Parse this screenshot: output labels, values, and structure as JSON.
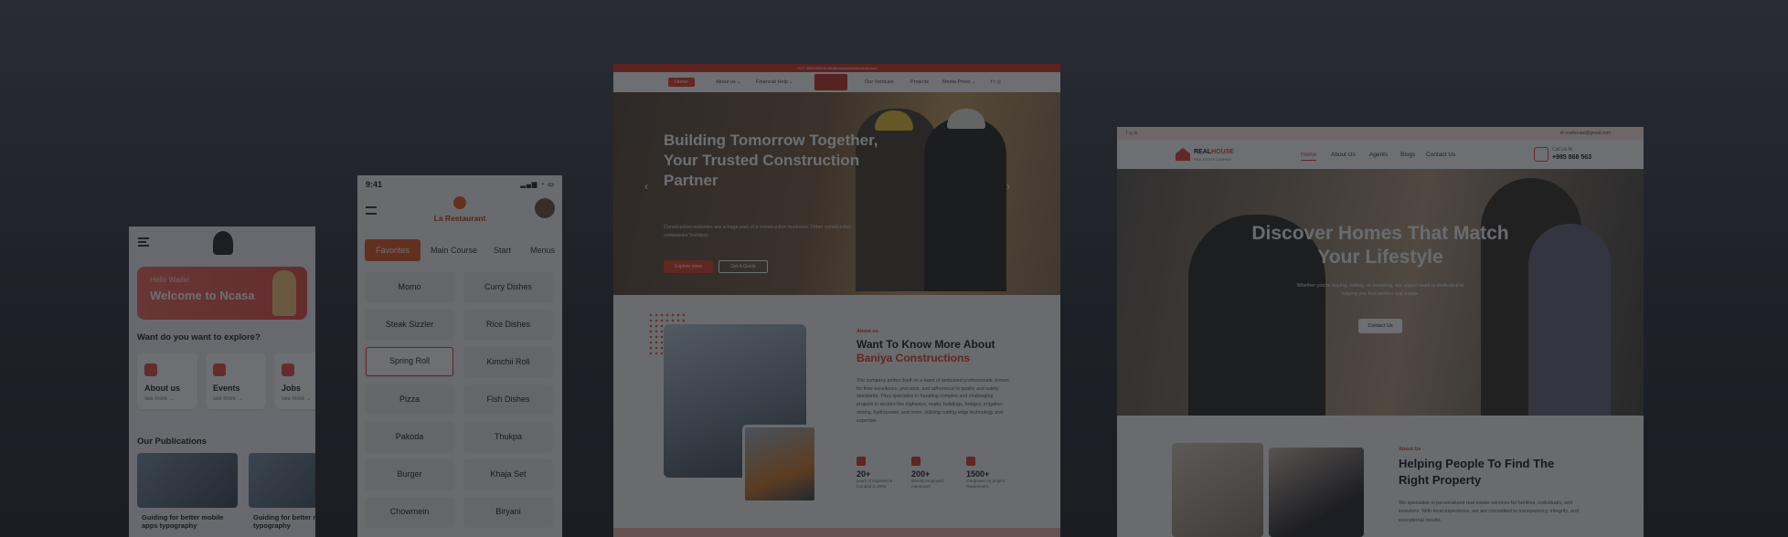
{
  "ncasa": {
    "hero_greeting": "Hello Wade!",
    "hero_title": "Welcome to Ncasa",
    "explore_question": "Want do you want to explore?",
    "tiles": [
      {
        "label": "About us",
        "more": "see more →"
      },
      {
        "label": "Events",
        "more": "see more →"
      },
      {
        "label": "Jobs",
        "more": "see more →"
      }
    ],
    "publications_title": "Our Publications",
    "publications": [
      {
        "title": "Guiding for better mobile apps typography"
      },
      {
        "title": "Guiding for better m apps typography"
      }
    ]
  },
  "restaurant": {
    "time": "9:41",
    "status_icons": "▂▄▆ ◔ ▭",
    "brand": "La Restaurant",
    "tabs": [
      "Favorites",
      "Main Course",
      "Start",
      "Menus"
    ],
    "items": [
      "Momo",
      "Curry Dishes",
      "Steak Sizzler",
      "Rice Dishes",
      "Spring Roll",
      "Kimchii Roll",
      "Pizza",
      "Fish Dishes",
      "Pakoda",
      "Thukpa",
      "Burger",
      "Khaja Set",
      "Chowmein",
      "Biryani"
    ],
    "selected_item": "Spring Roll"
  },
  "construction": {
    "topbar": "+977 9800000000    info@baniyaconstructions.com",
    "nav": {
      "home": "Home",
      "about": "About us ⌄",
      "financial": "Financial Help ⌄",
      "verticals": "Our Verticals",
      "projects": "Projects",
      "media": "Media Press ⌄",
      "social": "f  t  ◎"
    },
    "hero": {
      "title": "Building Tomorrow Together, Your Trusted Construction Partner",
      "subtitle": "Construction websites are a huge part of a construction business. Other construction companies' builders.",
      "primary_button": "Explore more",
      "secondary_button": "Get A Quote"
    },
    "about": {
      "eyebrow": "About us",
      "title": "Want To Know More About",
      "title_accent": "Baniya Constructions",
      "body": "The company prides itself on a team of dedicated professionals, known for their excellence, precision, and adherence to quality and safety standards. They specialize in handling complex and challenging projects in sectors like highways, roads, buildings, bridges, irrigation, mining, hydropower, and more, utilizing cutting-edge technology and expertise."
    },
    "stats": [
      {
        "value": "20+",
        "label": "years of experience · founded in 2008"
      },
      {
        "value": "200+",
        "label": "directly employed manpower"
      },
      {
        "value": "1500+",
        "label": "manpower on project requirement"
      }
    ]
  },
  "realhouse": {
    "topbar_left": "f  ◎  in",
    "topbar_right": "✉ realhouse@gmail.com",
    "brand": "REAL",
    "brand_accent": "HOUSE",
    "brand_tag": "REAL ESTATE COMPANY",
    "nav": [
      "Home",
      "About Us",
      "Agents",
      "Blogs",
      "Contact Us"
    ],
    "contact_label": "Call Us At",
    "contact_number": "+985 868 563",
    "hero": {
      "title": "Discover Homes That Match Your Lifestyle",
      "subtitle": "Whether you're buying, selling, or investing, our expert team is dedicated to helping you find perfect real estate.",
      "button": "Contact Us"
    },
    "about": {
      "eyebrow": "About Us",
      "title": "Helping People To Find The Right Property",
      "body": "We specialize in personalized real estate services for families, individuals, and investors. With local experience, we are committed to transparency, integrity, and exceptional results."
    }
  }
}
